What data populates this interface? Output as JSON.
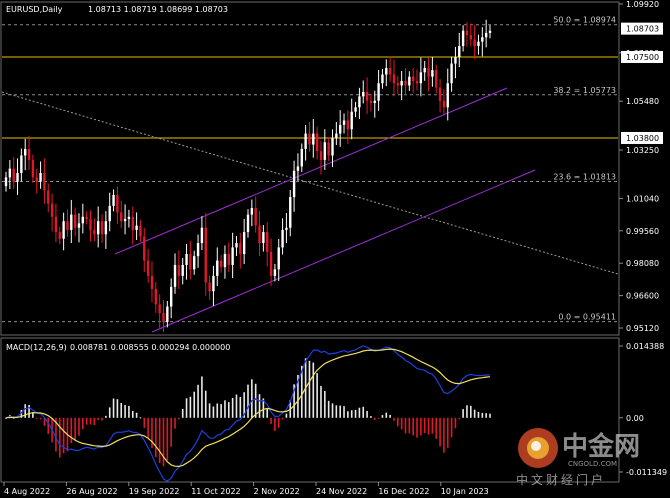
{
  "header": {
    "symbol_timeframe": "EURUSD,Daily",
    "ohlc": "1.08713 1.08719 1.08699 1.08703",
    "macd_label": "MACD(12,26,9)",
    "macd_values": "0.008781 0.008555 0.000294 0.000000"
  },
  "price_axis": {
    "ticks": [
      "1.09920",
      "1.07690",
      "1.05480",
      "1.03250",
      "1.01040",
      "0.99560",
      "0.98080",
      "0.96600",
      "0.95120"
    ],
    "ymax": 1.0992,
    "ymin": 0.9512
  },
  "macd_axis": {
    "ticks": [
      "0.014388",
      "0.00",
      "-0.011349"
    ],
    "ymax": 0.014388,
    "ymin": -0.011349
  },
  "current_price": {
    "label": "1.08703",
    "value": 1.08703
  },
  "horizontal_levels": [
    {
      "label": "1.07500",
      "value": 1.075,
      "color": "#e6c200"
    },
    {
      "label": "1.03800",
      "value": 1.038,
      "color": "#e6c200"
    }
  ],
  "fibonacci_levels": [
    {
      "label": "50.0 = 1.08974",
      "value": 1.08974
    },
    {
      "label": "38.2 = 1.05773",
      "value": 1.05773
    },
    {
      "label": "23.6 = 1.01813",
      "value": 1.01813
    },
    {
      "label": "0.0 = 0.95411",
      "value": 0.95411
    }
  ],
  "time_axis": [
    "4 Aug 2022",
    "26 Aug 2022",
    "19 Sep 2022",
    "11 Oct 2022",
    "2 Nov 2022",
    "24 Nov 2022",
    "16 Dec 2022",
    "10 Jan 2023"
  ],
  "watermark": {
    "brand": "中金网",
    "site": "CNGOLD.COM",
    "slogan": "中文财经门户"
  },
  "colors": {
    "background": "#000000",
    "bull": "#ffffff",
    "bear": "#e0182a",
    "channel": "#9b30d8",
    "level": "#e6c200",
    "macd_main": "#1f3fe0",
    "macd_signal": "#f0e060"
  },
  "chart_data": {
    "type": "candlestick",
    "symbol": "EURUSD",
    "timeframe": "Daily",
    "ylim": [
      0.9512,
      1.0992
    ],
    "candles_close": [
      1.02,
      1.024,
      1.018,
      1.022,
      1.03,
      1.033,
      1.028,
      1.02,
      1.018,
      1.022,
      1.014,
      1.008,
      1.002,
      0.995,
      0.992,
      1.0,
      0.996,
      1.003,
      0.997,
      0.999,
      1.002,
      1.001,
      0.996,
      0.994,
      1.0,
      0.994,
      1.0,
      1.007,
      1.012,
      1.004,
      1.0,
      1.001,
      1.002,
      0.996,
      0.998,
      0.993,
      0.982,
      0.975,
      0.969,
      0.962,
      0.958,
      0.954,
      0.961,
      0.97,
      0.98,
      0.975,
      0.98,
      0.985,
      0.978,
      0.984,
      0.99,
      0.997,
      0.972,
      0.968,
      0.975,
      0.982,
      0.979,
      0.985,
      0.98,
      0.988,
      0.99,
      0.985,
      0.995,
      1.003,
      1.006,
      0.998,
      0.99,
      0.995,
      0.986,
      0.975,
      0.978,
      0.988,
      0.996,
      0.997,
      1.011,
      1.023,
      1.025,
      1.033,
      1.04,
      1.035,
      1.04,
      1.032,
      1.028,
      1.036,
      1.03,
      1.038,
      1.04,
      1.044,
      1.046,
      1.042,
      1.05,
      1.052,
      1.057,
      1.059,
      1.055,
      1.054,
      1.055,
      1.063,
      1.067,
      1.07,
      1.067,
      1.063,
      1.062,
      1.064,
      1.062,
      1.066,
      1.064,
      1.063,
      1.068,
      1.07,
      1.066,
      1.069,
      1.061,
      1.055,
      1.052,
      1.063,
      1.072,
      1.075,
      1.08,
      1.087,
      1.085,
      1.083,
      1.08,
      1.082,
      1.084,
      1.086,
      1.087
    ]
  }
}
